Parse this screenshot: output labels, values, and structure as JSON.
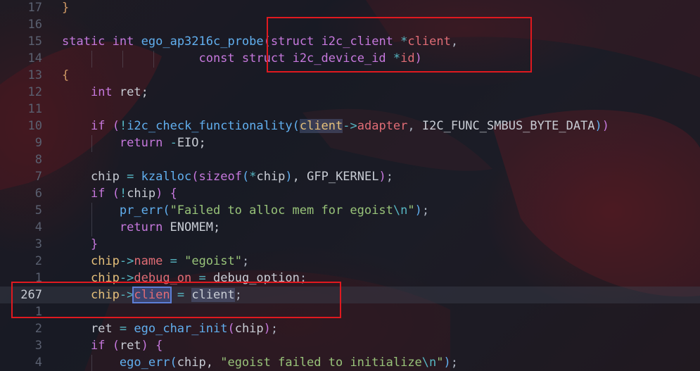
{
  "editor": {
    "current_line_number": "267",
    "lines": [
      {
        "gutter": "17",
        "tokens": [
          {
            "t": "}",
            "c": "br1"
          }
        ]
      },
      {
        "gutter": "16",
        "tokens": []
      },
      {
        "gutter": "15",
        "tokens": [
          {
            "t": "static",
            "c": "kw"
          },
          {
            "t": " ",
            "c": "pl"
          },
          {
            "t": "int",
            "c": "ty"
          },
          {
            "t": " ",
            "c": "pl"
          },
          {
            "t": "ego_ap3216c_probe",
            "c": "fn"
          },
          {
            "t": "(",
            "c": "br2"
          },
          {
            "t": "struct",
            "c": "kw"
          },
          {
            "t": " ",
            "c": "pl"
          },
          {
            "t": "i2c_client",
            "c": "ty"
          },
          {
            "t": " ",
            "c": "pl"
          },
          {
            "t": "*",
            "c": "op"
          },
          {
            "t": "client",
            "c": "pa"
          },
          {
            "t": ",",
            "c": "pu"
          }
        ]
      },
      {
        "gutter": "14",
        "tokens": [
          {
            "t": "                   ",
            "c": "pl"
          },
          {
            "t": "const",
            "c": "kw"
          },
          {
            "t": " ",
            "c": "pl"
          },
          {
            "t": "struct",
            "c": "kw"
          },
          {
            "t": " ",
            "c": "pl"
          },
          {
            "t": "i2c_device_id",
            "c": "ty"
          },
          {
            "t": " ",
            "c": "pl"
          },
          {
            "t": "*",
            "c": "op"
          },
          {
            "t": "id",
            "c": "pa"
          },
          {
            "t": ")",
            "c": "br2"
          }
        ]
      },
      {
        "gutter": "13",
        "tokens": [
          {
            "t": "{",
            "c": "br1"
          }
        ]
      },
      {
        "gutter": "12",
        "tokens": [
          {
            "t": "    ",
            "c": "pl"
          },
          {
            "t": "int",
            "c": "ty"
          },
          {
            "t": " ret;",
            "c": "pl"
          }
        ]
      },
      {
        "gutter": "11",
        "tokens": []
      },
      {
        "gutter": "10",
        "tokens": [
          {
            "t": "    ",
            "c": "pl"
          },
          {
            "t": "if",
            "c": "kw"
          },
          {
            "t": " ",
            "c": "pl"
          },
          {
            "t": "(",
            "c": "br2"
          },
          {
            "t": "!",
            "c": "op"
          },
          {
            "t": "i2c_check_functionality",
            "c": "fn"
          },
          {
            "t": "(",
            "c": "br3"
          },
          {
            "t": "client",
            "c": "yl hl"
          },
          {
            "t": "->",
            "c": "op"
          },
          {
            "t": "adapter",
            "c": "fd"
          },
          {
            "t": ", ",
            "c": "pu"
          },
          {
            "t": "I2C_FUNC_SMBUS_BYTE_DATA",
            "c": "pl"
          },
          {
            "t": ")",
            "c": "br3"
          },
          {
            "t": ")",
            "c": "br2"
          }
        ]
      },
      {
        "gutter": "9",
        "tokens": [
          {
            "t": "        ",
            "c": "pl"
          },
          {
            "t": "return",
            "c": "kw"
          },
          {
            "t": " ",
            "c": "pl"
          },
          {
            "t": "-",
            "c": "op"
          },
          {
            "t": "EIO;",
            "c": "pl"
          }
        ]
      },
      {
        "gutter": "8",
        "tokens": []
      },
      {
        "gutter": "7",
        "tokens": [
          {
            "t": "    chip ",
            "c": "pl"
          },
          {
            "t": "=",
            "c": "op"
          },
          {
            "t": " ",
            "c": "pl"
          },
          {
            "t": "kzalloc",
            "c": "fn"
          },
          {
            "t": "(",
            "c": "br2"
          },
          {
            "t": "sizeof",
            "c": "kw"
          },
          {
            "t": "(",
            "c": "br3"
          },
          {
            "t": "*",
            "c": "op"
          },
          {
            "t": "chip",
            "c": "pl"
          },
          {
            "t": ")",
            "c": "br3"
          },
          {
            "t": ", GFP_KERNEL",
            "c": "pl"
          },
          {
            "t": ")",
            "c": "br2"
          },
          {
            "t": ";",
            "c": "pu"
          }
        ]
      },
      {
        "gutter": "6",
        "tokens": [
          {
            "t": "    ",
            "c": "pl"
          },
          {
            "t": "if",
            "c": "kw"
          },
          {
            "t": " ",
            "c": "pl"
          },
          {
            "t": "(",
            "c": "br2"
          },
          {
            "t": "!",
            "c": "op"
          },
          {
            "t": "chip",
            "c": "pl"
          },
          {
            "t": ")",
            "c": "br2"
          },
          {
            "t": " ",
            "c": "pl"
          },
          {
            "t": "{",
            "c": "br2"
          }
        ]
      },
      {
        "gutter": "5",
        "tokens": [
          {
            "t": "        ",
            "c": "pl"
          },
          {
            "t": "pr_err",
            "c": "fn"
          },
          {
            "t": "(",
            "c": "br3"
          },
          {
            "t": "\"Failed to alloc mem for egoist",
            "c": "st"
          },
          {
            "t": "\\n",
            "c": "es"
          },
          {
            "t": "\"",
            "c": "st"
          },
          {
            "t": ")",
            "c": "br3"
          },
          {
            "t": ";",
            "c": "pu"
          }
        ]
      },
      {
        "gutter": "4",
        "tokens": [
          {
            "t": "        ",
            "c": "pl"
          },
          {
            "t": "return",
            "c": "kw"
          },
          {
            "t": " ENOMEM;",
            "c": "pl"
          }
        ]
      },
      {
        "gutter": "3",
        "tokens": [
          {
            "t": "    ",
            "c": "pl"
          },
          {
            "t": "}",
            "c": "br2"
          }
        ]
      },
      {
        "gutter": "2",
        "tokens": [
          {
            "t": "    ",
            "c": "pl"
          },
          {
            "t": "chip",
            "c": "yl"
          },
          {
            "t": "->",
            "c": "op"
          },
          {
            "t": "name",
            "c": "fd"
          },
          {
            "t": " ",
            "c": "pl"
          },
          {
            "t": "=",
            "c": "op"
          },
          {
            "t": " ",
            "c": "pl"
          },
          {
            "t": "\"egoist\"",
            "c": "st"
          },
          {
            "t": ";",
            "c": "pu"
          }
        ]
      },
      {
        "gutter": "1",
        "tokens": [
          {
            "t": "    ",
            "c": "pl"
          },
          {
            "t": "chip",
            "c": "yl"
          },
          {
            "t": "->",
            "c": "op"
          },
          {
            "t": "debug_on",
            "c": "fd"
          },
          {
            "t": " ",
            "c": "pl"
          },
          {
            "t": "=",
            "c": "op"
          },
          {
            "t": " debug_option",
            "c": "pl"
          },
          {
            "t": ";",
            "c": "pu"
          }
        ]
      },
      {
        "gutter": "267",
        "current": true,
        "tokens": [
          {
            "t": "    ",
            "c": "pl"
          },
          {
            "t": "chip",
            "c": "yl"
          },
          {
            "t": "->",
            "c": "op"
          },
          {
            "t": "clien",
            "c": "fd sel"
          },
          {
            "t": " ",
            "c": "pl"
          },
          {
            "t": "=",
            "c": "op"
          },
          {
            "t": " ",
            "c": "pl"
          },
          {
            "t": "client",
            "c": "pl hl"
          },
          {
            "t": ";",
            "c": "pu"
          }
        ]
      },
      {
        "gutter": "1",
        "tokens": []
      },
      {
        "gutter": "2",
        "tokens": [
          {
            "t": "    ret ",
            "c": "pl"
          },
          {
            "t": "=",
            "c": "op"
          },
          {
            "t": " ",
            "c": "pl"
          },
          {
            "t": "ego_char_init",
            "c": "fn"
          },
          {
            "t": "(",
            "c": "br2"
          },
          {
            "t": "chip",
            "c": "pl"
          },
          {
            "t": ")",
            "c": "br2"
          },
          {
            "t": ";",
            "c": "pu"
          }
        ]
      },
      {
        "gutter": "3",
        "tokens": [
          {
            "t": "    ",
            "c": "pl"
          },
          {
            "t": "if",
            "c": "kw"
          },
          {
            "t": " ",
            "c": "pl"
          },
          {
            "t": "(",
            "c": "br2"
          },
          {
            "t": "ret",
            "c": "pl"
          },
          {
            "t": ")",
            "c": "br2"
          },
          {
            "t": " ",
            "c": "pl"
          },
          {
            "t": "{",
            "c": "br2"
          }
        ]
      },
      {
        "gutter": "4",
        "tokens": [
          {
            "t": "        ",
            "c": "pl"
          },
          {
            "t": "ego_err",
            "c": "fn"
          },
          {
            "t": "(",
            "c": "br3"
          },
          {
            "t": "chip, ",
            "c": "pl"
          },
          {
            "t": "\"egoist failed to initialize",
            "c": "st"
          },
          {
            "t": "\\n",
            "c": "es"
          },
          {
            "t": "\"",
            "c": "st"
          },
          {
            "t": ")",
            "c": "br3"
          },
          {
            "t": ";",
            "c": "pu"
          }
        ]
      }
    ]
  },
  "colors": {
    "annotation_box": "#e0191f",
    "keyword": "#c678dd",
    "function": "#61afef",
    "string": "#98c379"
  }
}
